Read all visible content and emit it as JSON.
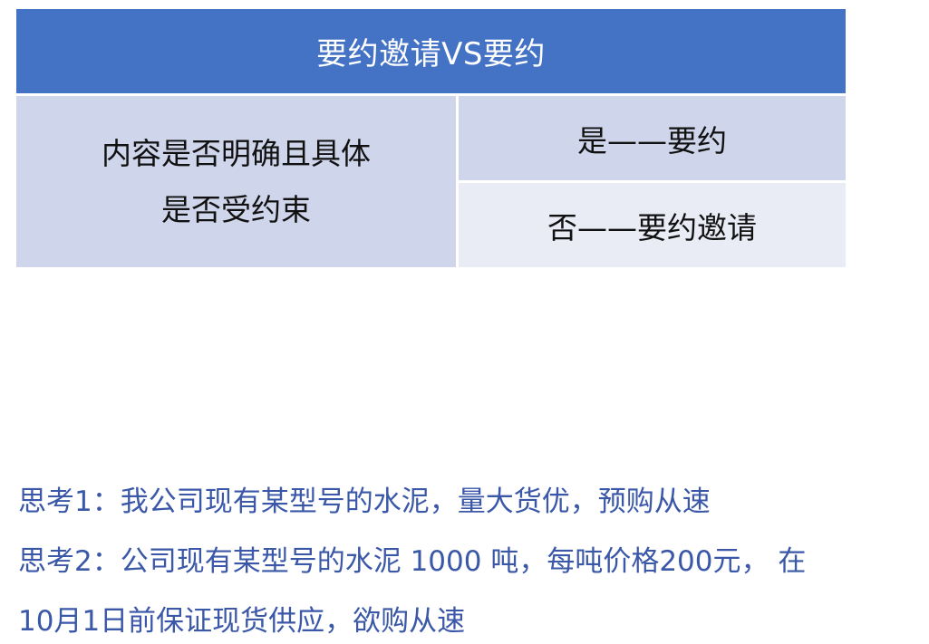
{
  "table": {
    "header": "要约邀请VS要约",
    "left_lines": [
      "内容是否明确且具体",
      "是否受约束"
    ],
    "right_top": "是——要约",
    "right_bottom": "否——要约邀请"
  },
  "thinking": {
    "line1": "思考1：我公司现有某型号的水泥，量大货优，预购从速",
    "line2": "思考2：公司现有某型号的水泥 1000 吨，每吨价格200元， 在",
    "line3": "10月1日前保证现货供应，欲购从速"
  }
}
